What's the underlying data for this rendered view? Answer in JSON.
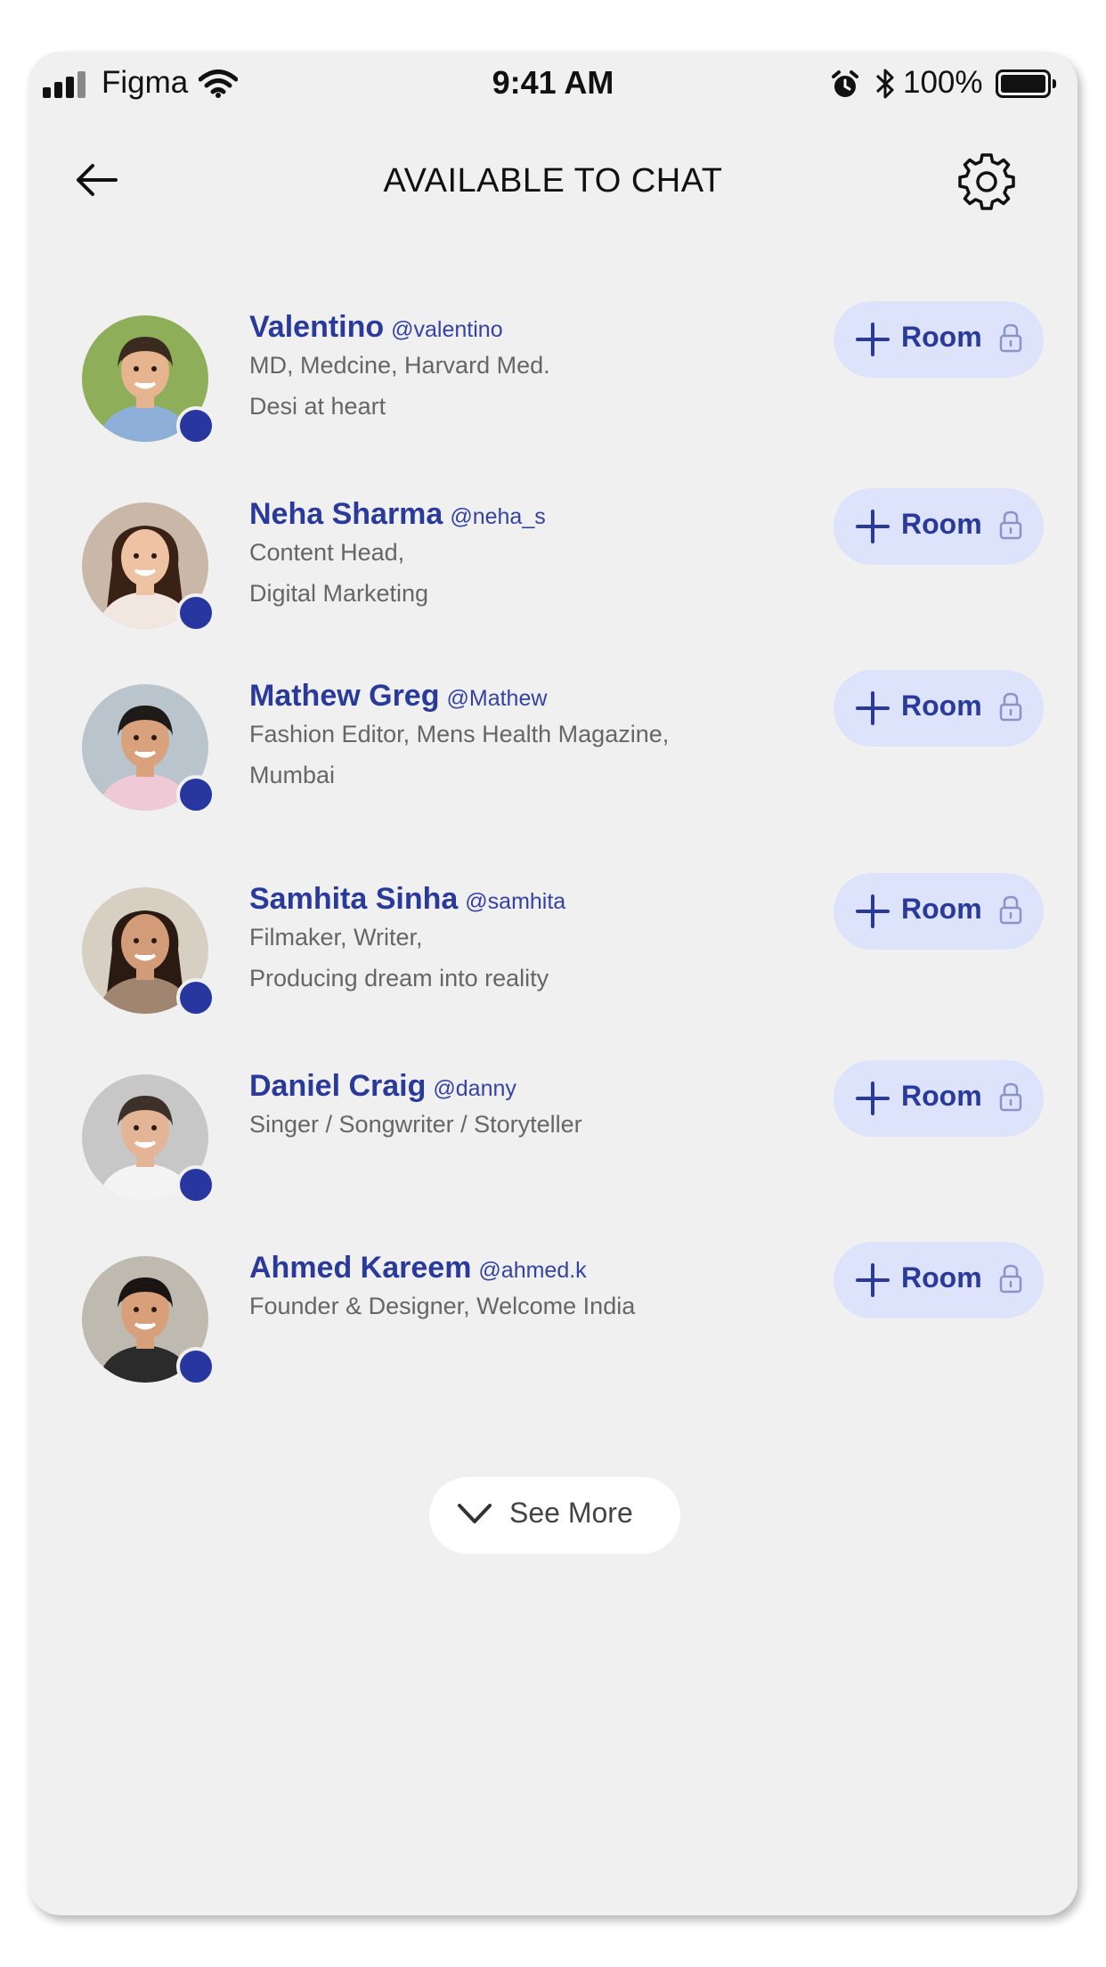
{
  "status_bar": {
    "carrier": "Figma",
    "time": "9:41 AM",
    "battery_percent": "100%",
    "signal_bars": 4,
    "battery_level": 1.0
  },
  "header": {
    "title": "AVAILABLE TO CHAT",
    "back_icon": "arrow-left-icon",
    "settings_icon": "gear-icon"
  },
  "users": [
    {
      "name": "Valentino",
      "handle": "@valentino",
      "desc_line1": "MD, Medcine, Harvard Med.",
      "desc_line2": "Desi at heart",
      "room_label": "Room"
    },
    {
      "name": "Neha Sharma",
      "handle": "@neha_s",
      "desc_line1": "Content Head,",
      "desc_line2": "Digital Marketing",
      "room_label": "Room"
    },
    {
      "name": "Mathew Greg",
      "handle": "@Mathew",
      "desc_line1": "Fashion Editor, Mens Health Magazine,",
      "desc_line2": "Mumbai",
      "room_label": "Room"
    },
    {
      "name": "Samhita Sinha",
      "handle": "@samhita",
      "desc_line1": "Filmaker, Writer,",
      "desc_line2": "Producing dream into reality",
      "room_label": "Room"
    },
    {
      "name": "Daniel Craig",
      "handle": "@danny",
      "desc_line1": "Singer / Songwriter / Storyteller",
      "desc_line2": "",
      "room_label": "Room"
    },
    {
      "name": "Ahmed Kareem",
      "handle": "@ahmed.k",
      "desc_line1": "Founder & Designer, Welcome India",
      "desc_line2": "",
      "room_label": "Room"
    }
  ],
  "see_more": {
    "label": "See More",
    "icon": "chevron-down-icon"
  },
  "colors": {
    "accent": "#2a3a9a",
    "online": "#2837a0",
    "room_button_bg": "#dde3fb",
    "screen_bg": "#f0f0f0"
  }
}
